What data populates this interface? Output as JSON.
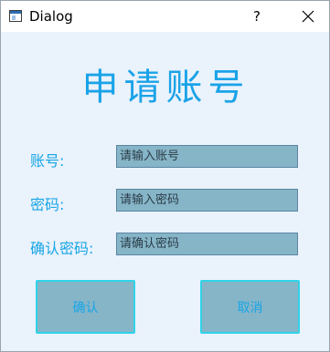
{
  "window": {
    "title": "Dialog",
    "help_label": "?"
  },
  "heading": "申请账号",
  "form": {
    "account_label": "账号:",
    "account_placeholder": "请输入账号",
    "password_label": "密码:",
    "password_placeholder": "请输入密码",
    "confirm_label": "确认密码:",
    "confirm_placeholder": "请确认密码"
  },
  "buttons": {
    "confirm": "确认",
    "cancel": "取消"
  },
  "colors": {
    "accent": "#18a6e6",
    "field_bg": "#86b5c8",
    "button_border": "#2fd3e8",
    "window_bg": "#eaf2fb"
  },
  "icons": {
    "app": "dialog-window-icon",
    "help": "question-mark",
    "close": "close-x"
  }
}
